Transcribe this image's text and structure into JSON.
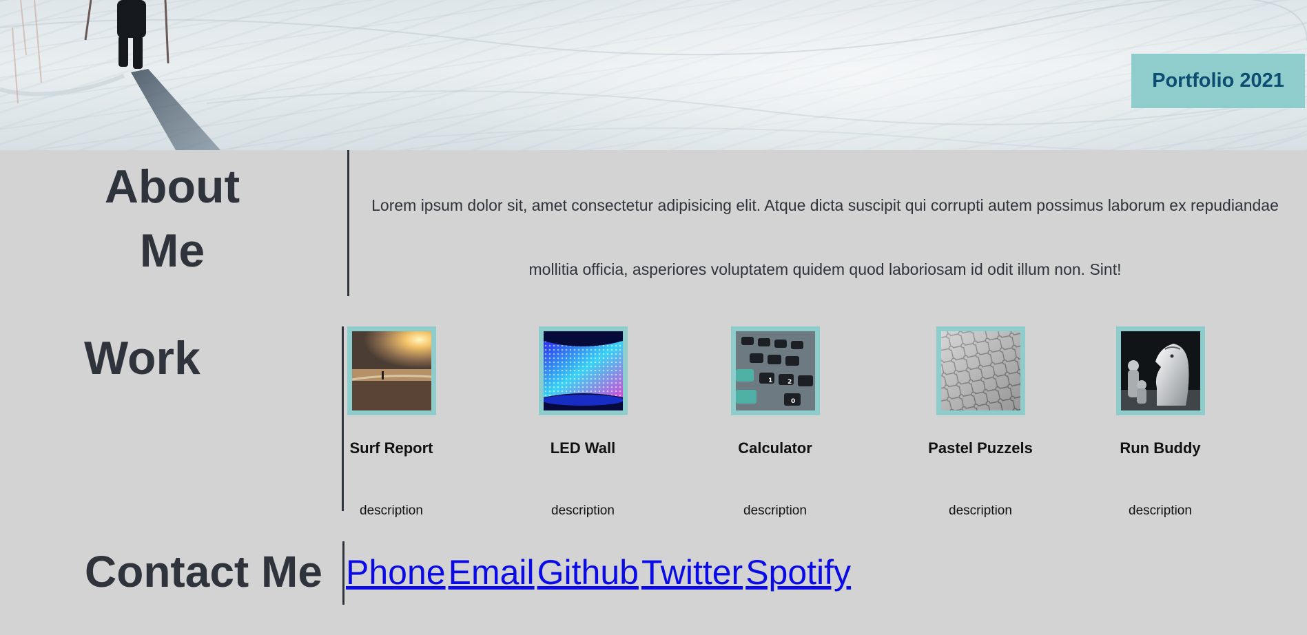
{
  "hero": {
    "badge_text": "Portfolio 2021"
  },
  "about": {
    "heading_line1": "About",
    "heading_line2": "Me",
    "text": "Lorem ipsum dolor sit, amet consectetur adipisicing elit. Atque dicta suscipit qui corrupti autem possimus laborum ex repudiandae mollitia officia, asperiores voluptatem quidem quod laboriosam id odit illum non. Sint!"
  },
  "work": {
    "heading": "Work",
    "projects": [
      {
        "title": "Surf Report",
        "description": "description",
        "image": "beach-sunset-image"
      },
      {
        "title": "LED Wall",
        "description": "description",
        "image": "led-grid-image"
      },
      {
        "title": "Calculator",
        "description": "description",
        "image": "calculator-keys-image"
      },
      {
        "title": "Pastel Puzzels",
        "description": "description",
        "image": "puzzle-pieces-image"
      },
      {
        "title": "Run Buddy",
        "description": "description",
        "image": "chess-knight-image"
      }
    ]
  },
  "contact": {
    "heading": "Contact Me",
    "links": [
      "Phone",
      "Email",
      "Github",
      "Twitter",
      "Spotify"
    ]
  },
  "colors": {
    "page_background": "#d3d3d3",
    "heading_text": "#2f333b",
    "accent": "#8fcdcd",
    "badge_text": "#0e4d72",
    "link": "#0a0ae6"
  }
}
